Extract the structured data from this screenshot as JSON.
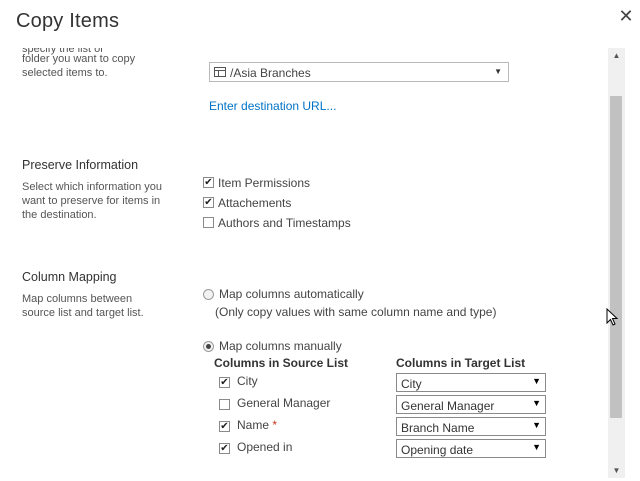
{
  "dialog": {
    "title": "Copy Items",
    "close_symbol": "✕"
  },
  "destination": {
    "description_partial": "specify the list or",
    "description_line2": "folder you want to copy",
    "description_line3": "selected items to.",
    "selected_value": "/Asia Branches",
    "enter_url_link": "Enter destination URL..."
  },
  "preserve": {
    "title": "Preserve Information",
    "description": [
      "Select which information you",
      "want to preserve for items in",
      "the destination."
    ],
    "options": [
      {
        "label": "Item Permissions",
        "checked": true
      },
      {
        "label": "Attachements",
        "checked": true
      },
      {
        "label": "Authors and Timestamps",
        "checked": false
      }
    ]
  },
  "mapping": {
    "title": "Column Mapping",
    "description": [
      "Map columns between",
      "source list and target list."
    ],
    "auto_label": "Map columns automatically",
    "auto_note": "(Only copy values with same column name and type)",
    "manual_label": "Map columns manually",
    "selected_mode": "manual",
    "source_header": "Columns in Source List",
    "target_header": "Columns in Target List",
    "rows": [
      {
        "source": "City",
        "required": false,
        "checked": true,
        "target": "City"
      },
      {
        "source": "General Manager",
        "required": false,
        "checked": false,
        "target": "General Manager"
      },
      {
        "source": "Name",
        "required": true,
        "checked": true,
        "target": "Branch Name"
      },
      {
        "source": "Opened in",
        "required": false,
        "checked": true,
        "target": "Opening date"
      }
    ],
    "required_marker": "*"
  },
  "icons": {
    "check": "✔",
    "dropdown": "▼",
    "scroll_up": "▲",
    "scroll_down": "▼"
  }
}
